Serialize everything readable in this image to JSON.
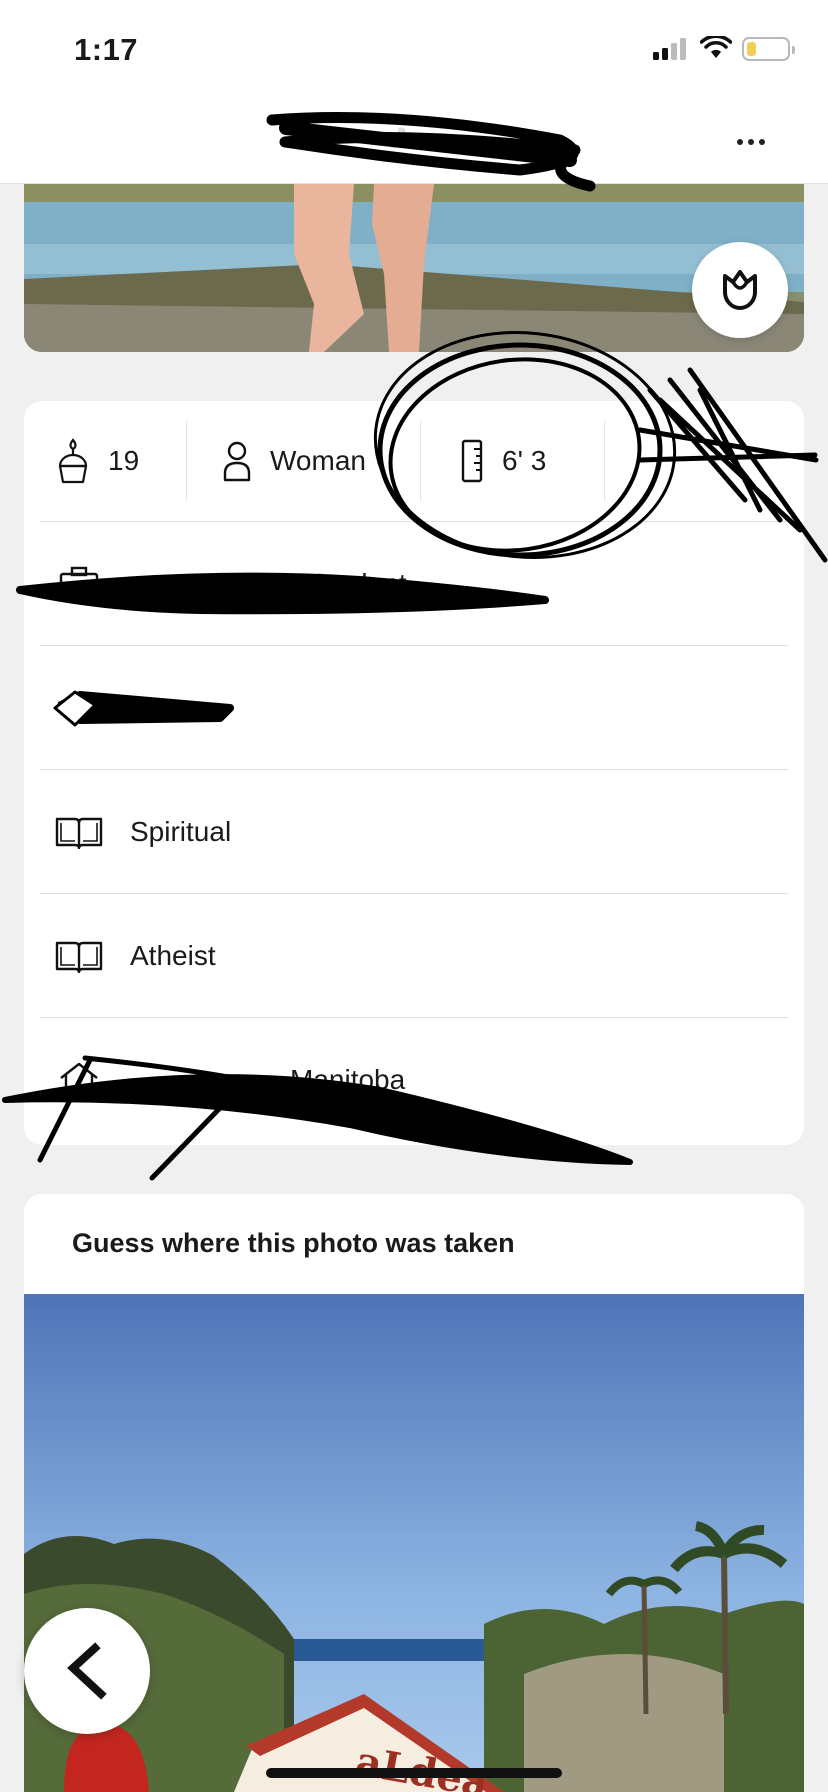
{
  "status_bar": {
    "time": "1:17"
  },
  "header": {
    "name": "A..."
  },
  "vitals": [
    {
      "icon": "birthday-cake-icon",
      "value": "19"
    },
    {
      "icon": "person-icon",
      "value": "Woman"
    },
    {
      "icon": "ruler-icon",
      "value": "6' 3"
    }
  ],
  "info_rows": [
    {
      "icon": "briefcase-icon",
      "text": "Student"
    },
    {
      "icon": "graduation-cap-icon",
      "text": ""
    },
    {
      "icon": "book-icon",
      "text": "Spiritual"
    },
    {
      "icon": "book-icon",
      "text": "Atheist"
    },
    {
      "icon": "home-icon",
      "text": "Manitoba"
    }
  ],
  "prompt": {
    "title": "Guess where this photo was taken",
    "sign_text": "aLdea"
  },
  "colors": {
    "background": "#f0f0f0",
    "card": "#ffffff",
    "battery": "#f2cf55",
    "text": "#1a1a1a"
  }
}
